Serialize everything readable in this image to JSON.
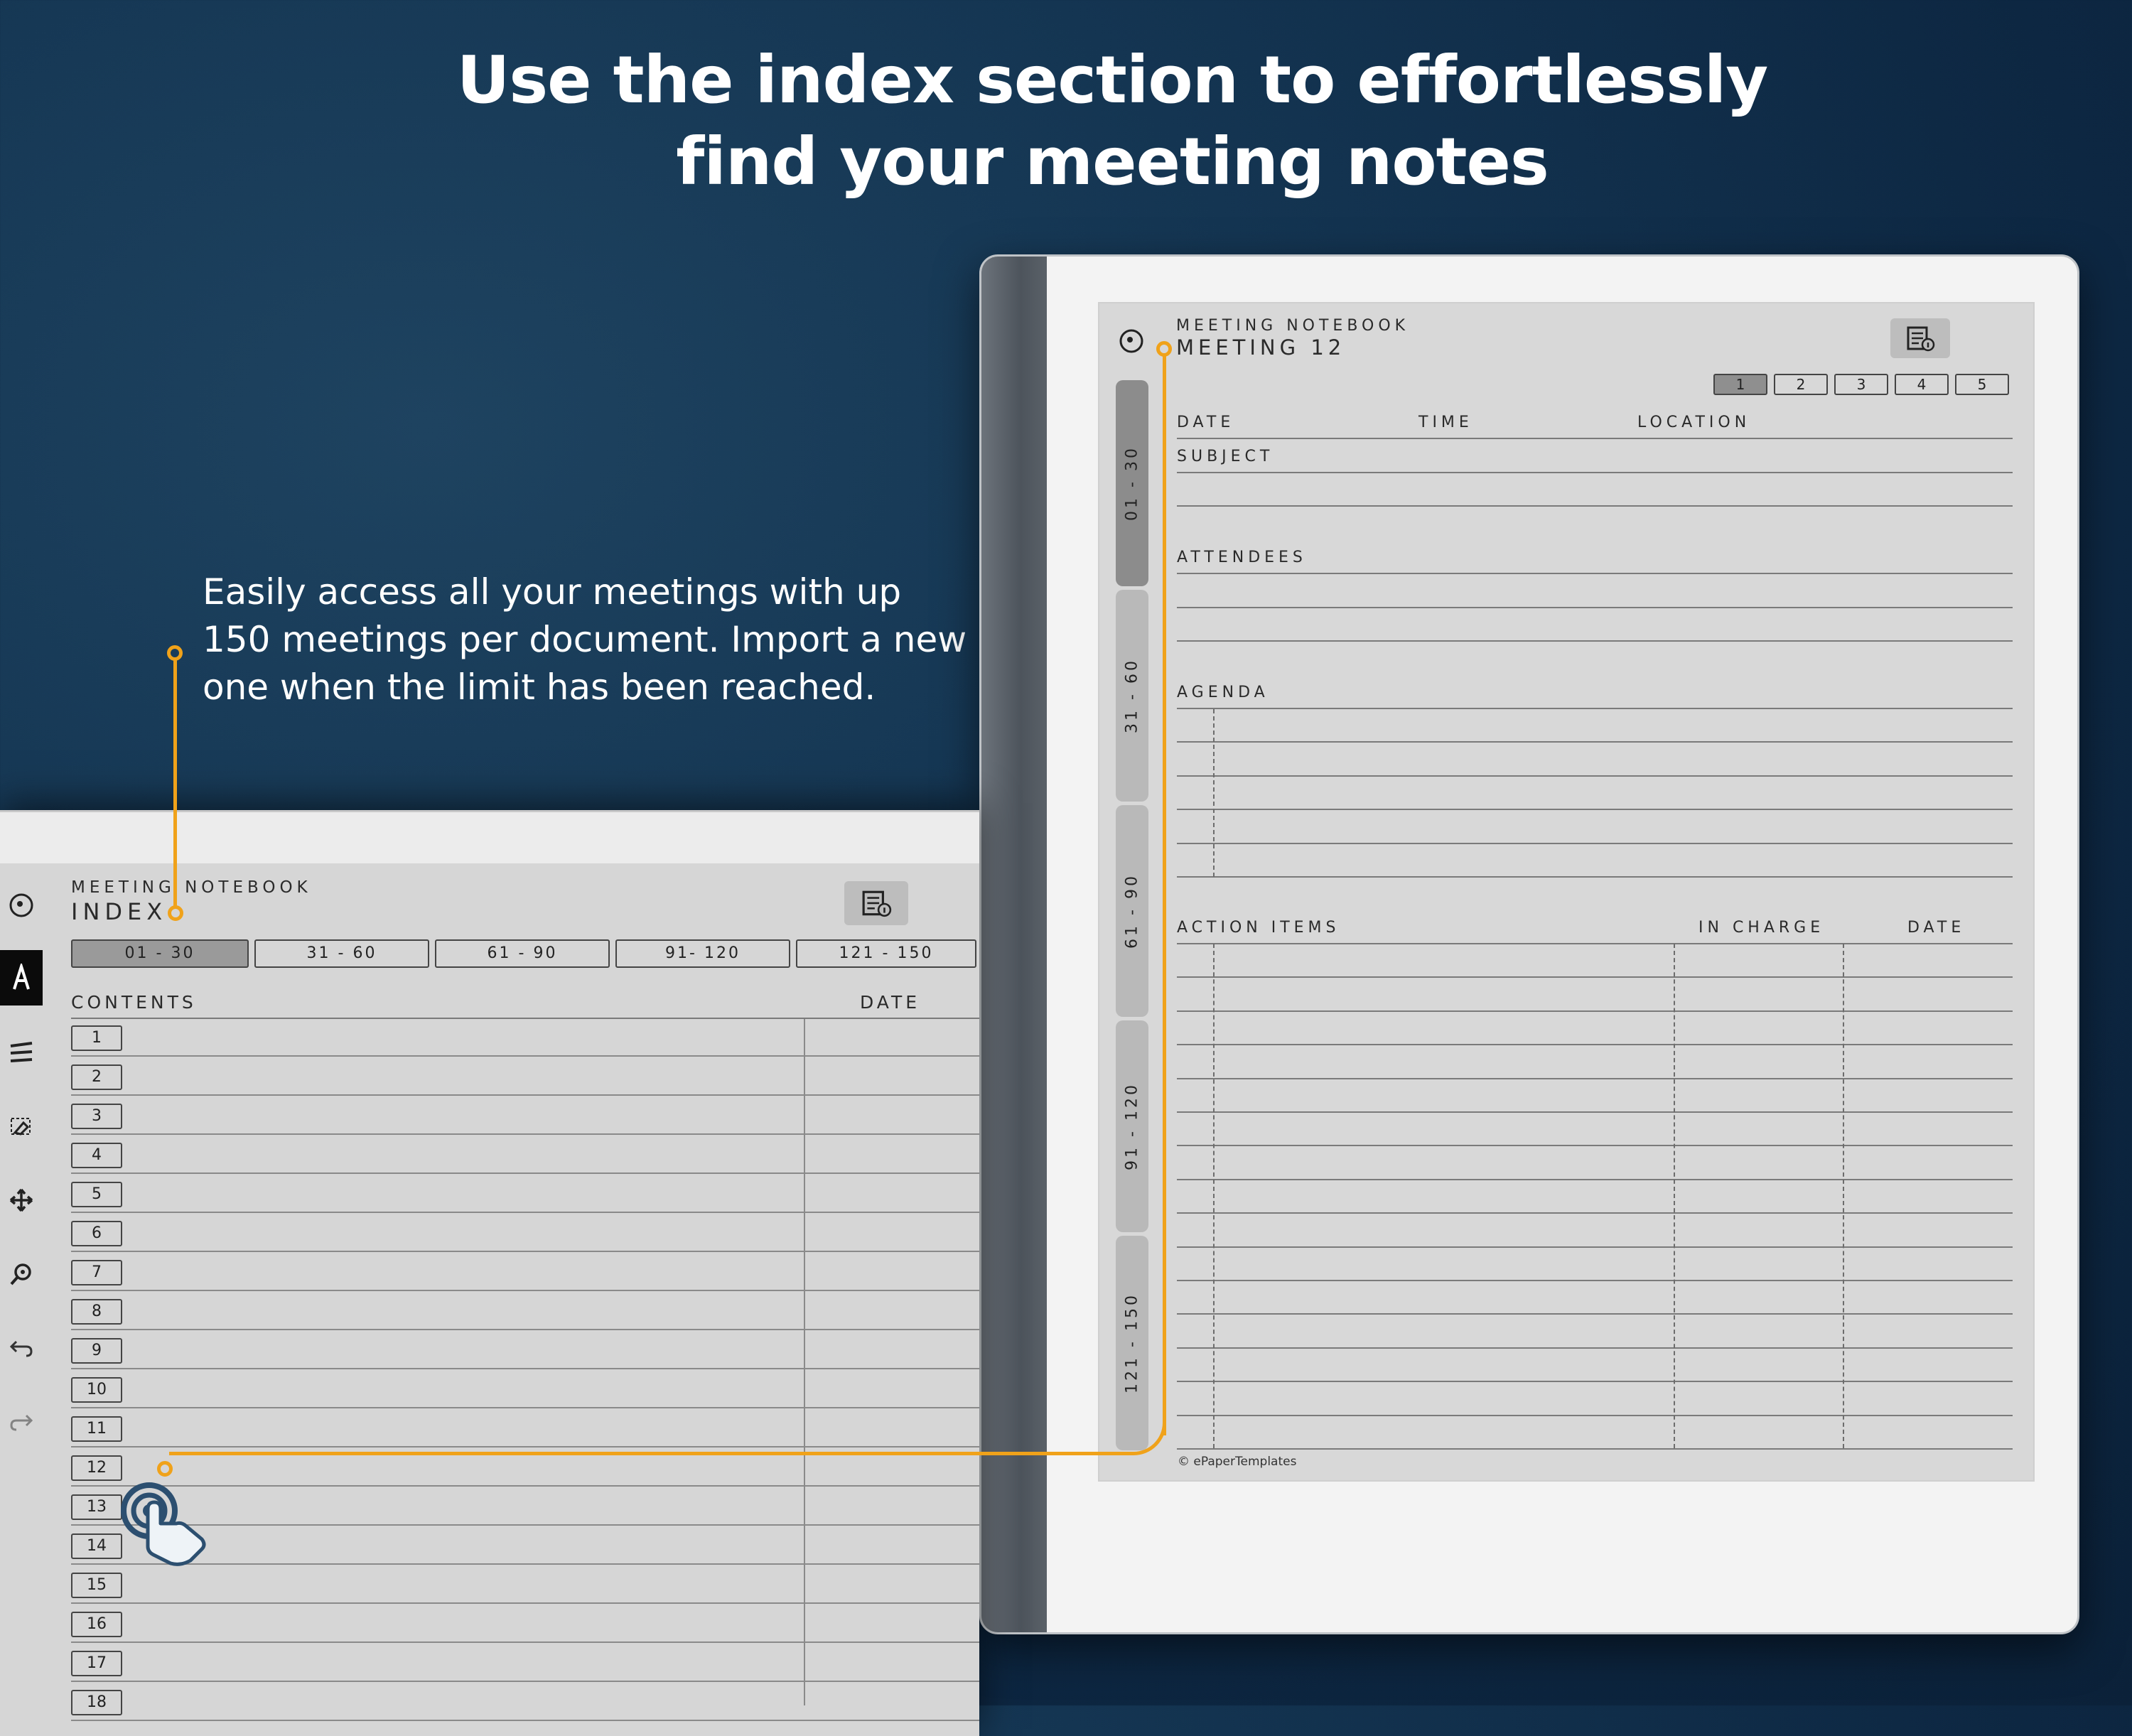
{
  "headline": {
    "line1": "Use the index section to effortlessly",
    "line2": "find your meeting notes"
  },
  "callout": {
    "line1": "Easily access all your meetings with up",
    "line2": "150 meetings per document. Import a new",
    "line3": "one when the limit has been reached."
  },
  "meeting_page": {
    "notebook_label": "MEETING NOTEBOOK",
    "title": "MEETING 12",
    "page_tabs": [
      "1",
      "2",
      "3",
      "4",
      "5"
    ],
    "active_page_tab": "1",
    "fields": {
      "date": "DATE",
      "time": "TIME",
      "location": "LOCATION",
      "subject": "SUBJECT",
      "attendees": "ATTENDEES",
      "agenda": "AGENDA"
    },
    "action_items": {
      "label": "ACTION ITEMS",
      "in_charge": "IN CHARGE",
      "date": "DATE"
    },
    "side_tabs": [
      "01 - 30",
      "31 - 60",
      "61 - 90",
      "91 - 120",
      "121 - 150"
    ],
    "footer": "© ePaperTemplates"
  },
  "index_page": {
    "notebook_label": "MEETING NOTEBOOK",
    "title": "INDEX",
    "range_tabs": [
      "01 - 30",
      "31 - 60",
      "61 - 90",
      "91- 120",
      "121 - 150"
    ],
    "active_range_tab": "01 - 30",
    "contents_label": "CONTENTS",
    "date_label": "DATE",
    "rows": [
      "1",
      "2",
      "3",
      "4",
      "5",
      "6",
      "7",
      "8",
      "9",
      "10",
      "11",
      "12",
      "13",
      "14",
      "15",
      "16",
      "17",
      "18"
    ]
  },
  "toolbar": {
    "icons": [
      "circle-menu-icon",
      "pen-icon",
      "lines-icon",
      "eraser-icon",
      "move-icon",
      "zoom-icon",
      "undo-icon",
      "redo-icon"
    ]
  },
  "colors": {
    "accent": "#f0a21a",
    "background": "#0d2742",
    "screen": "#d8d8d8"
  }
}
